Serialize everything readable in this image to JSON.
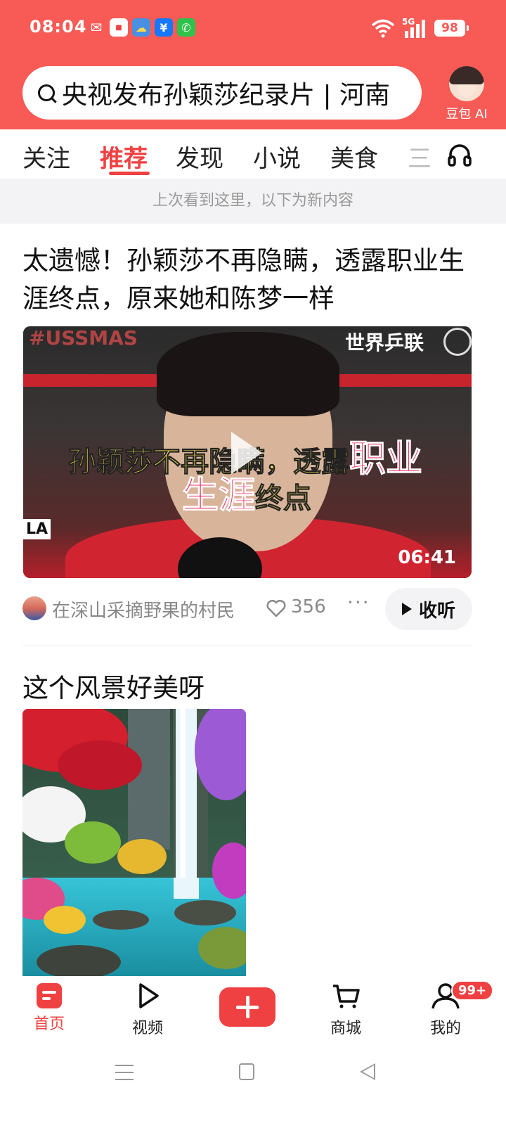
{
  "status_bar": {
    "time": "08:04",
    "network": "5G",
    "battery": "98",
    "app_icons": [
      "wechat-icon",
      "toutiao-icon",
      "weather-icon",
      "alipay-icon",
      "phone-icon"
    ]
  },
  "search": {
    "text": "央视发布孙颖莎纪录片 | 河南"
  },
  "ai_entry": {
    "label": "豆包 AI"
  },
  "tabs": [
    {
      "label": "关注",
      "active": false
    },
    {
      "label": "推荐",
      "active": true
    },
    {
      "label": "发现",
      "active": false
    },
    {
      "label": "小说",
      "active": false
    },
    {
      "label": "美食",
      "active": false
    },
    {
      "label": "三",
      "active": false
    }
  ],
  "notice": "上次看到这里，以下为新内容",
  "feed": [
    {
      "title": "太遗憾！孙颖莎不再隐瞒，透露职业生涯终点，原来她和陈梦一样",
      "video": {
        "tag_left": "#USSMAS",
        "tag_right": "世界乒联",
        "side_tag": "LA",
        "caption_line1_a": "孙颖莎不再隐瞒，透露",
        "caption_line1_b": "职业",
        "caption_line2_a": "生涯",
        "caption_line2_b": "终点",
        "duration": "06:41"
      },
      "source": "在深山采摘野果的村民",
      "likes": "356",
      "more": "···",
      "listen_label": "收听"
    },
    {
      "title": "这个风景好美呀"
    }
  ],
  "bottom_nav": [
    {
      "label": "首页",
      "icon": "home-icon",
      "active": true
    },
    {
      "label": "视频",
      "icon": "play-icon",
      "active": false
    },
    {
      "label": "",
      "icon": "plus-icon",
      "active": false
    },
    {
      "label": "商城",
      "icon": "cart-icon",
      "active": false
    },
    {
      "label": "我的",
      "icon": "user-icon",
      "active": false,
      "badge": "99+"
    }
  ],
  "colors": {
    "brand": "#f85a55",
    "accent": "#f04142"
  }
}
